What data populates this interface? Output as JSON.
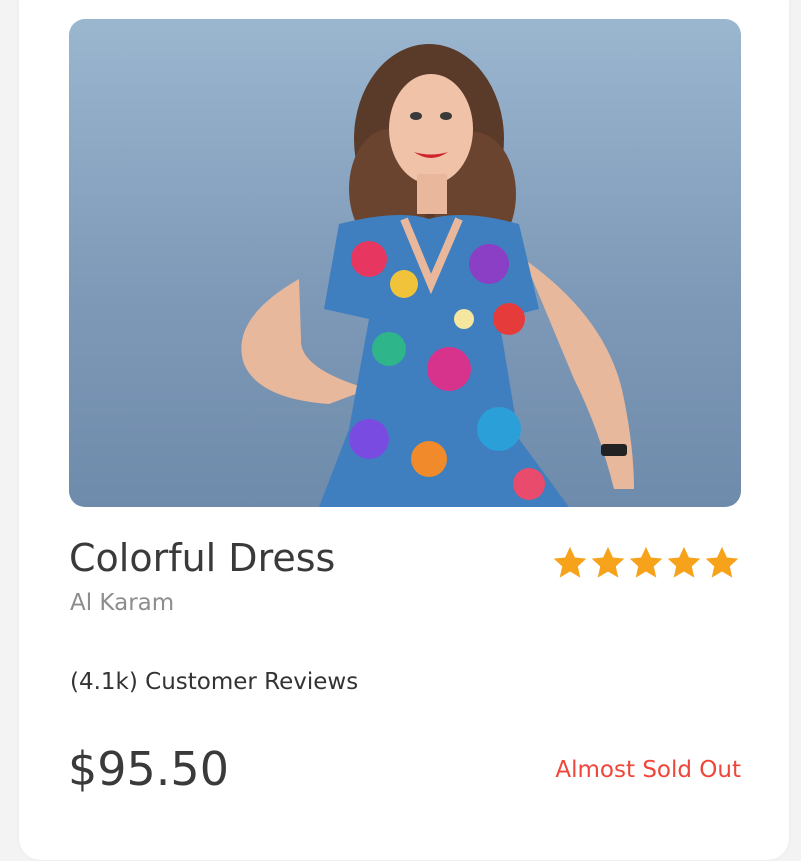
{
  "product": {
    "name": "Colorful Dress",
    "brand": "Al Karam",
    "rating": 5,
    "rating_max": 5,
    "reviews_text": "(4.1k) Customer Reviews",
    "price": "$95.50",
    "stock_status": "Almost Sold Out",
    "image_icon": "product-photo"
  },
  "colors": {
    "star": "#f7a21b",
    "stock_status": "#f0453a",
    "title": "#3a3a3a",
    "brand": "#8d8d8d"
  }
}
